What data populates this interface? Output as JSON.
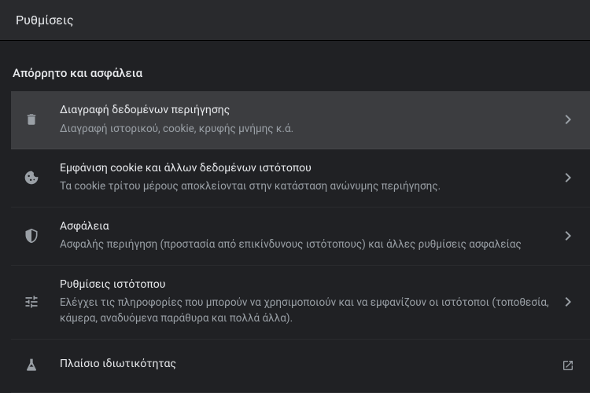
{
  "header": {
    "title": "Ρυθμίσεις"
  },
  "section": {
    "title": "Απόρρητο και ασφάλεια",
    "items": [
      {
        "title": "Διαγραφή δεδομένων περιήγησης",
        "description": "Διαγραφή ιστορικού, cookie, κρυφής μνήμης κ.ά."
      },
      {
        "title": "Εμφάνιση cookie και άλλων δεδομένων ιστότοπου",
        "description": "Τα cookie τρίτου μέρους αποκλείονται στην κατάσταση ανώνυμης περιήγησης."
      },
      {
        "title": "Ασφάλεια",
        "description": "Ασφαλής περιήγηση (προστασία από επικίνδυνους ιστότοπους) και άλλες ρυθμίσεις ασφαλείας"
      },
      {
        "title": "Ρυθμίσεις ιστότοπου",
        "description": "Ελέγχει τις πληροφορίες που μπορούν να χρησιμοποιούν και να εμφανίζουν οι ιστότοποι (τοποθεσία, κάμερα, αναδυόμενα παράθυρα και πολλά άλλα)."
      },
      {
        "title": "Πλαίσιο ιδιωτικότητας",
        "description": ""
      }
    ]
  }
}
